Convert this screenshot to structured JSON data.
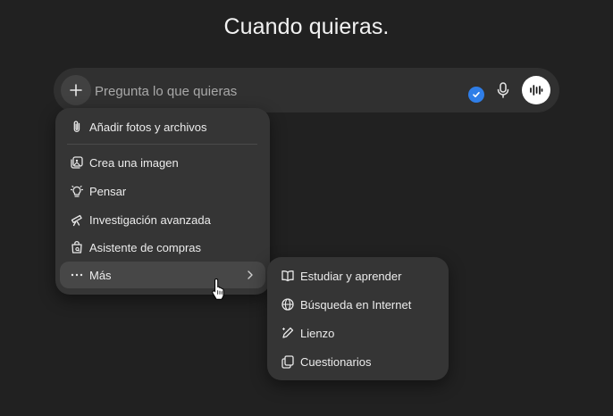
{
  "headline": "Cuando quieras.",
  "composer": {
    "placeholder": "Pregunta lo que quieras",
    "icons": [
      "plus-icon",
      "check-badge-icon",
      "microphone-icon",
      "voice-mode-icon"
    ]
  },
  "attach_menu": {
    "items": [
      {
        "label": "Añadir fotos y archivos",
        "icon": "paperclip-icon"
      },
      {
        "label": "Crea una imagen",
        "icon": "image-create-icon"
      },
      {
        "label": "Pensar",
        "icon": "lightbulb-icon"
      },
      {
        "label": "Investigación avanzada",
        "icon": "telescope-icon"
      },
      {
        "label": "Asistente de compras",
        "icon": "shopping-bag-icon"
      },
      {
        "label": "Más",
        "icon": "more-dots-icon",
        "submenu": true,
        "highlighted": true
      }
    ]
  },
  "more_menu": {
    "items": [
      {
        "label": "Estudiar y aprender",
        "icon": "book-icon"
      },
      {
        "label": "Búsqueda en Internet",
        "icon": "globe-icon"
      },
      {
        "label": "Lienzo",
        "icon": "pencil-icon"
      },
      {
        "label": "Cuestionarios",
        "icon": "cards-icon"
      }
    ]
  },
  "colors": {
    "background": "#212121",
    "composer": "#303030",
    "menu": "#353535",
    "menu_hover": "#474747",
    "check_badge": "#2f7ee8",
    "voice_button": "#ffffff"
  }
}
